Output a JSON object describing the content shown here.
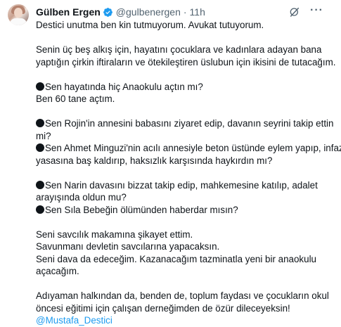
{
  "tweet": {
    "author_name": "Gülben Ergen",
    "handle": "@gulbenergen",
    "separator": "·",
    "time": "11h",
    "more_label": "···",
    "lines": {
      "l1": "Destici unutma ben kin tutmuyorum. Avukat tutuyorum.",
      "l2": "Senin üç beş alkış için, hayatını çocuklara ve kadınlara adayan bana",
      "l3": "yaptığın çirkin iftiraların ve ötekileştiren üslubun için ikisini de tutacağım.",
      "l4": "Sen hayatında hiç Anaokulu açtın mı?",
      "l5": "Ben 60 tane açtım.",
      "l6": "Sen Rojin'in annesini babasını ziyaret edip, davanın seyrini takip ettin",
      "l7": "mi?",
      "l8": "Sen Ahmet Minguzi'nin acılı annesiyle beton üstünde eylem yapıp, infaz",
      "l9": "yasasına baş kaldırıp, haksızlık karşısında haykırdın mı?",
      "l10": "Sen Narin davasını bizzat takip edip, mahkemesine katılıp, adalet",
      "l11": "arayışında oldun mu?",
      "l12": "Sen Sıla Bebeğin ölümünden haberdar mısın?",
      "l13": "Seni savcılık makamına şikayet ettim.",
      "l14": "Savunmanı devletin savcılarına yapacaksın.",
      "l15": "Seni dava da edeceğim. Kazanacağım tazminatla yeni bir anaokulu",
      "l16": "açacağım.",
      "l17": "Adıyaman halkından da, benden de, toplum faydası ve çocukların okul",
      "l18": "öncesi eğitimi için çalışan derneğimden de özür dileceyeksin!",
      "mention": "@Mustafa_Destici"
    }
  },
  "colors": {
    "text": "#0f1419",
    "secondary": "#536471",
    "accent": "#1d9bf0"
  },
  "icons": [
    "verified-badge-icon",
    "grok-icon",
    "more-options-icon",
    "bullet-icon"
  ]
}
